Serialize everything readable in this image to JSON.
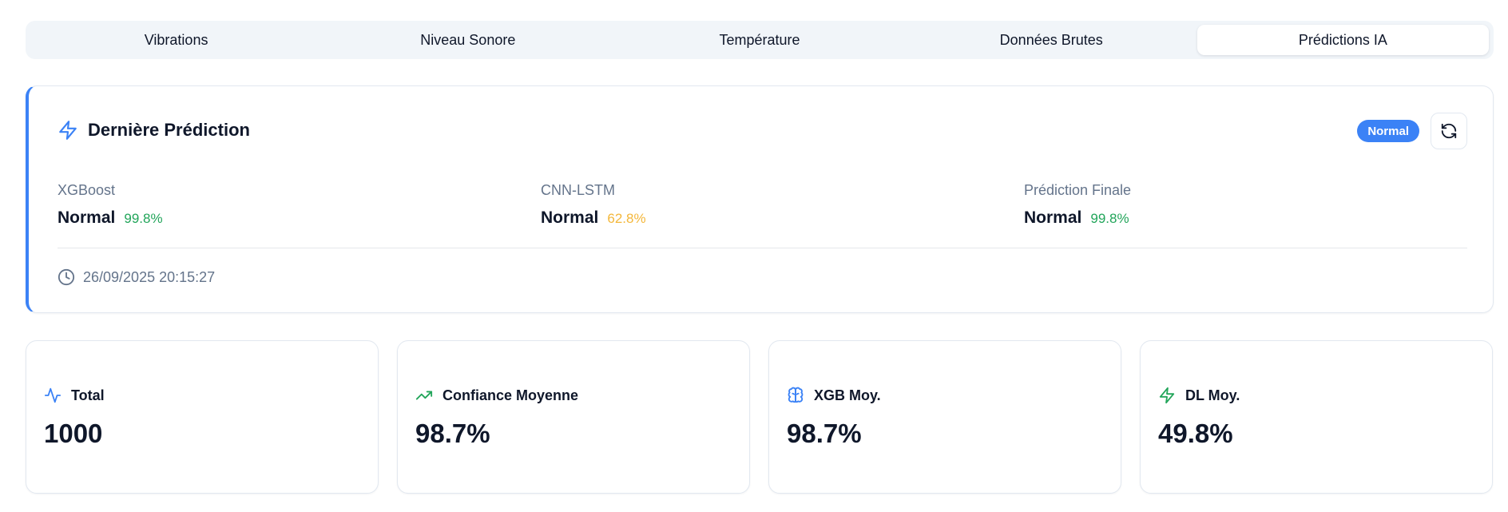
{
  "tabs": [
    {
      "label": "Vibrations",
      "active": false
    },
    {
      "label": "Niveau Sonore",
      "active": false
    },
    {
      "label": "Température",
      "active": false
    },
    {
      "label": "Données Brutes",
      "active": false
    },
    {
      "label": "Prédictions IA",
      "active": true
    }
  ],
  "prediction": {
    "title": "Dernière Prédiction",
    "badge": "Normal",
    "icon": "zap-icon",
    "models": [
      {
        "name": "XGBoost",
        "label": "Normal",
        "confidence": "99.8%",
        "color": "#22a55a"
      },
      {
        "name": "CNN-LSTM",
        "label": "Normal",
        "confidence": "62.8%",
        "color": "#f4b73a"
      },
      {
        "name": "Prédiction Finale",
        "label": "Normal",
        "confidence": "99.8%",
        "color": "#22a55a"
      }
    ],
    "timestamp": "26/09/2025 20:15:27"
  },
  "stats": [
    {
      "label": "Total",
      "value": "1000",
      "icon": "activity-icon",
      "color": "#3b82f6"
    },
    {
      "label": "Confiance Moyenne",
      "value": "98.7%",
      "icon": "trending-up-icon",
      "color": "#22a55a"
    },
    {
      "label": "XGB Moy.",
      "value": "98.7%",
      "icon": "brain-icon",
      "color": "#3b82f6"
    },
    {
      "label": "DL Moy.",
      "value": "49.8%",
      "icon": "zap-icon",
      "color": "#22a55a"
    }
  ],
  "colors": {
    "accent": "#3b82f6",
    "success": "#22a55a",
    "warning": "#f4b73a",
    "muted": "#64748b"
  }
}
